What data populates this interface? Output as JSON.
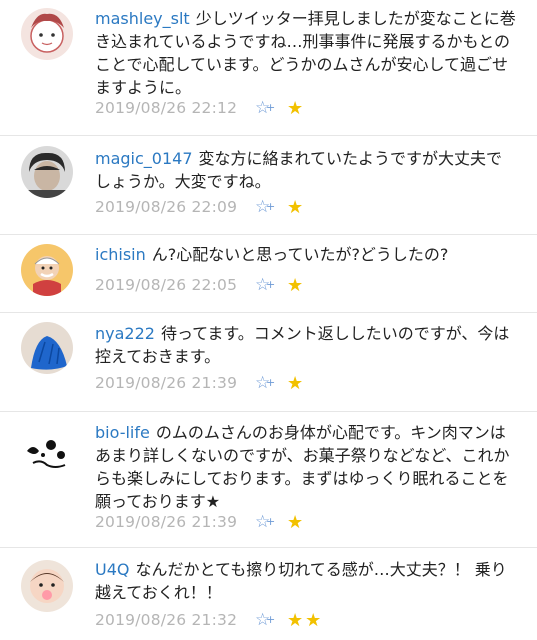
{
  "comments": [
    {
      "user": "mashley_slt",
      "text": "少しツイッター拝見しましたが変なことに巻き込まれているようですね…刑事事件に発展するかもとのことで心配しています。どうかのムさんが安心して過ごせますように。",
      "time": "2019/08/26 22:12",
      "stars": "★",
      "fav_icon": "favorite-add-icon"
    },
    {
      "user": "magic_0147",
      "text": "変な方に絡まれていたようですが大丈夫でしょうか。大変ですね。",
      "time": "2019/08/26 22:09",
      "stars": "★",
      "fav_icon": "favorite-add-icon"
    },
    {
      "user": "ichisin",
      "text": "ん?心配ないと思っていたが?どうしたの?",
      "time": "2019/08/26 22:05",
      "stars": "★",
      "fav_icon": "favorite-add-icon"
    },
    {
      "user": "nya222",
      "text": "待ってます。コメント返ししたいのですが、今は控えておきます。",
      "time": "2019/08/26 21:39",
      "stars": "★",
      "fav_icon": "favorite-add-icon"
    },
    {
      "user": "bio-life",
      "text": "のムのムさんのお身体が心配です。キン肉マンはあまり詳しくないのですが、お菓子祭りなどなど、これからも楽しみにしております。まずはゆっくり眠れることを願っております★",
      "time": "2019/08/26 21:39",
      "stars": "★",
      "fav_icon": "favorite-add-icon"
    },
    {
      "user": "U4Q",
      "text": "なんだかとても擦り切れてる感が…大丈夫？！ 乗り越えておくれ！！",
      "time": "2019/08/26 21:32",
      "stars": "★★",
      "fav_icon": "favorite-add-icon"
    }
  ]
}
